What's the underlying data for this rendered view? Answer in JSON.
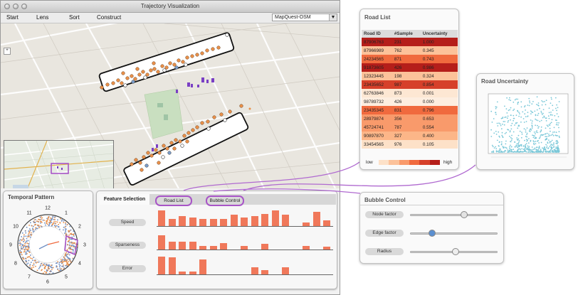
{
  "window": {
    "title": "Trajectory Visualization"
  },
  "menu": [
    "Start",
    "Lens",
    "Sort",
    "Construct"
  ],
  "tile_select": {
    "value": "MapQuest-OSM"
  },
  "temporal": {
    "title": "Temporal Pattern",
    "hours": [
      "12",
      "1",
      "2",
      "3",
      "4",
      "5",
      "6",
      "7",
      "8",
      "9",
      "10",
      "11"
    ]
  },
  "feature": {
    "title": "Feature Selection",
    "tabs": [
      "Road List",
      "Bubble Control"
    ],
    "rows": [
      {
        "label": "Speed",
        "bars": [
          0.85,
          0.4,
          0.55,
          0.45,
          0.4,
          0.4,
          0.4,
          0.6,
          0.45,
          0.55,
          0.65,
          0.85,
          0.6,
          0,
          0.2,
          0.75,
          0.3
        ]
      },
      {
        "label": "Sparseness",
        "bars": [
          0.8,
          0.45,
          0.45,
          0.45,
          0.2,
          0.2,
          0.35,
          0,
          0.2,
          0,
          0.3,
          0,
          0,
          0,
          0.2,
          0,
          0.15
        ]
      },
      {
        "label": "Error",
        "bars": [
          0.9,
          0.85,
          0.15,
          0.15,
          0.75,
          0,
          0,
          0,
          0,
          0.35,
          0.2,
          0,
          0.35,
          0,
          0,
          0,
          0
        ]
      }
    ]
  },
  "road_list": {
    "title": "Road List",
    "columns": [
      "Road ID",
      "#Sample",
      "Uncertainty"
    ],
    "rows": [
      [
        "87906763",
        "231",
        "1.000"
      ],
      [
        "87966989",
        "762",
        "0.345"
      ],
      [
        "24234565",
        "871",
        "0.743"
      ],
      [
        "91873605",
        "426",
        "0.986"
      ],
      [
        "12323445",
        "198",
        "0.324"
      ],
      [
        "23435652",
        "987",
        "0.854"
      ],
      [
        "62763846",
        "873",
        "0.001"
      ],
      [
        "98789732",
        "426",
        "0.000"
      ],
      [
        "23435345",
        "831",
        "0.796"
      ],
      [
        "28979874",
        "356",
        "0.653"
      ],
      [
        "45724741",
        "787",
        "0.554"
      ],
      [
        "90897870",
        "327",
        "0.400"
      ],
      [
        "33454565",
        "976",
        "0.105"
      ]
    ],
    "legend": {
      "low": "low",
      "high": "high",
      "colors": [
        "#fde1c8",
        "#fcc29a",
        "#f99a6b",
        "#f06a3e",
        "#d6402a",
        "#b51e1a"
      ]
    }
  },
  "road_uncertainty": {
    "title": "Road Uncertainty"
  },
  "bubble_control": {
    "title": "Bubble Control",
    "sliders": [
      {
        "label": "Node factor",
        "level": 0.62,
        "knob_color": "#e4e4e4"
      },
      {
        "label": "Edge factor",
        "level": 0.25,
        "knob_color": "#5b8fd0"
      },
      {
        "label": "Radius",
        "level": 0.52,
        "knob_color": "#eeeeee"
      }
    ]
  },
  "colors": {
    "accent_purple": "#a855c7",
    "bar": "#f0785a",
    "cyan": "#4fb6cc",
    "orange_node": "#e9904a"
  }
}
